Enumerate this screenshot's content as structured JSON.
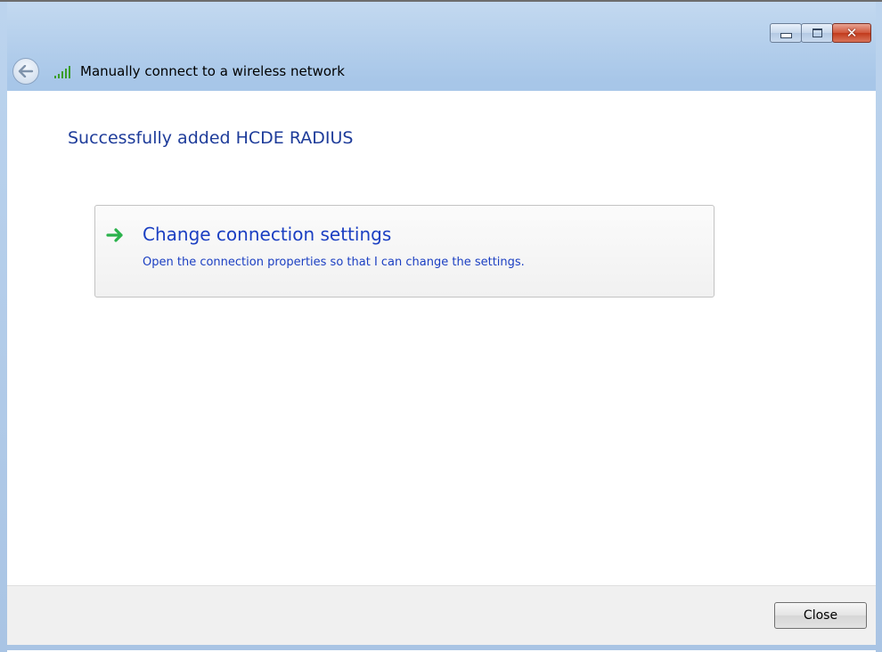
{
  "window": {
    "title": "Manually connect to a wireless network",
    "caption_buttons": [
      "minimize",
      "maximize",
      "close"
    ]
  },
  "navbar": {
    "back_icon": "back-arrow-icon",
    "network_icon": "wireless-signal-icon"
  },
  "content": {
    "heading": "Successfully added HCDE RADIUS",
    "command_link": {
      "icon": "green-arrow-icon",
      "title": "Change connection settings",
      "description": "Open the connection properties so that I can change the settings."
    }
  },
  "footer": {
    "close_label": "Close"
  },
  "colors": {
    "link_blue": "#1b3fc2",
    "heading_blue": "#1e3c9a",
    "frame_blue": "#a7c6e8",
    "arrow_green": "#2bb24c"
  }
}
